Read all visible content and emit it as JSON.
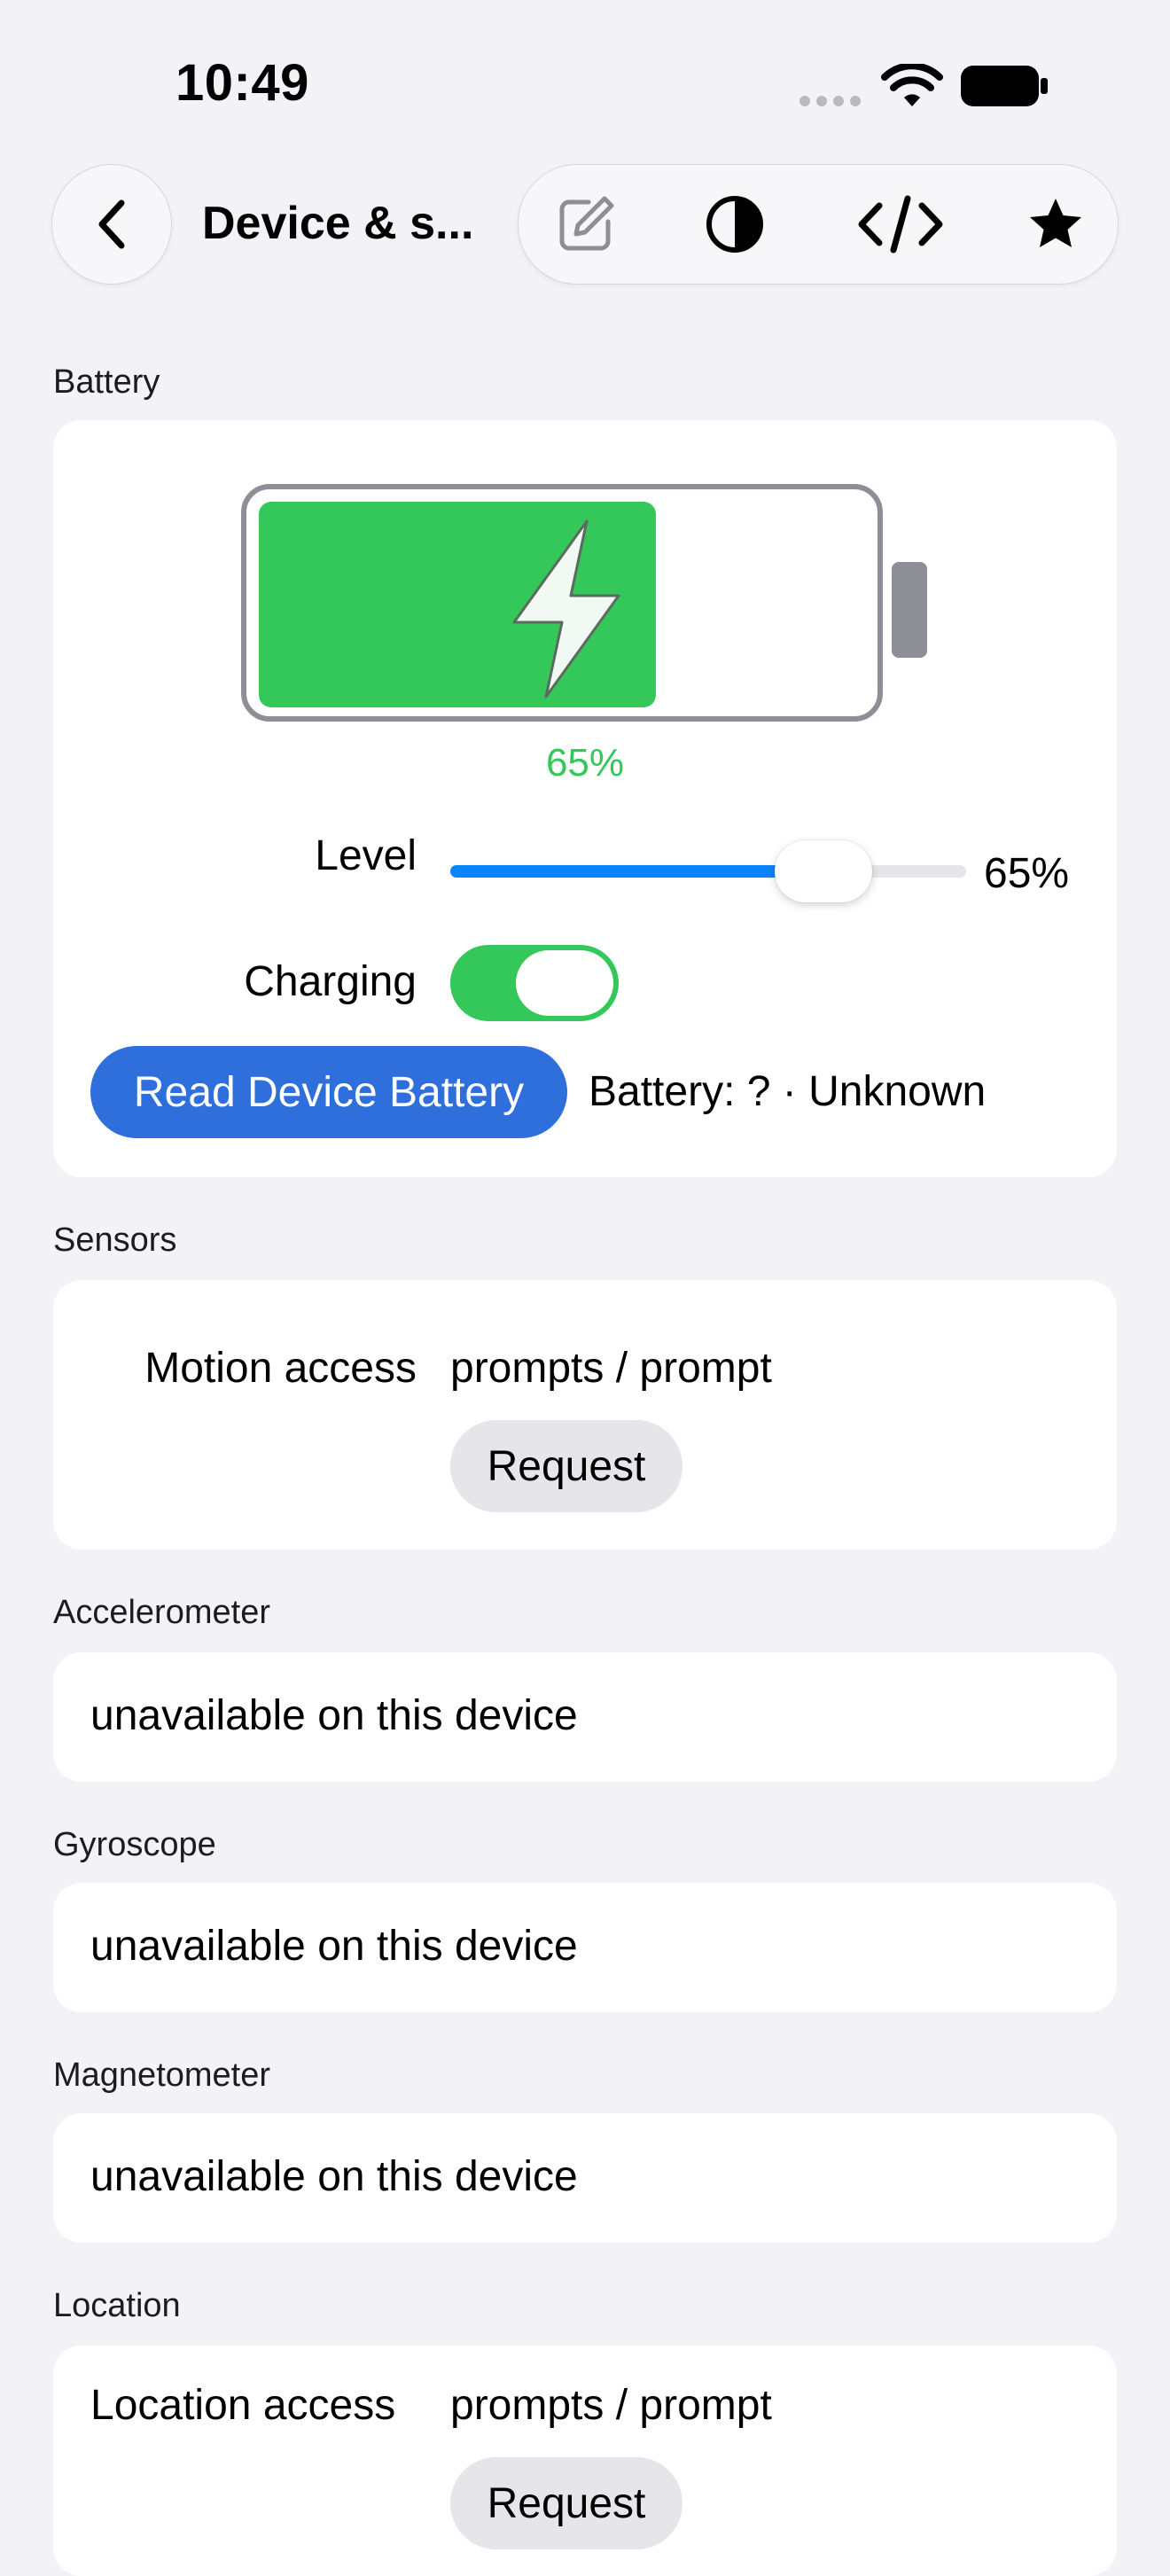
{
  "status_bar": {
    "time": "10:49"
  },
  "nav": {
    "back_icon": "chevron-left-icon",
    "title": "Device & s..."
  },
  "toolbar": {
    "icons": [
      "edit-icon",
      "contrast-icon",
      "code-icon",
      "star-icon"
    ]
  },
  "battery": {
    "section_label": "Battery",
    "charge_percent_caption": "65%",
    "charge_level": 0.65,
    "level_label": "Level",
    "level_value_text": "65%",
    "charging_label": "Charging",
    "charging_on": true,
    "read_button_label": "Read Device Battery",
    "status_text": "Battery: ? · Unknown"
  },
  "sensors": {
    "section_label": "Sensors",
    "motion_label": "Motion access",
    "motion_status": "prompts / prompt",
    "request_label": "Request"
  },
  "accelerometer": {
    "section_label": "Accelerometer",
    "value": "unavailable on this device"
  },
  "gyroscope": {
    "section_label": "Gyroscope",
    "value": "unavailable on this device"
  },
  "magnetometer": {
    "section_label": "Magnetometer",
    "value": "unavailable on this device"
  },
  "location": {
    "section_label": "Location",
    "access_label": "Location access",
    "access_status": "prompts / prompt",
    "request_label": "Request"
  },
  "colors": {
    "accent_blue": "#2f6fdc",
    "slider_blue": "#0a84ff",
    "green": "#34c759"
  }
}
